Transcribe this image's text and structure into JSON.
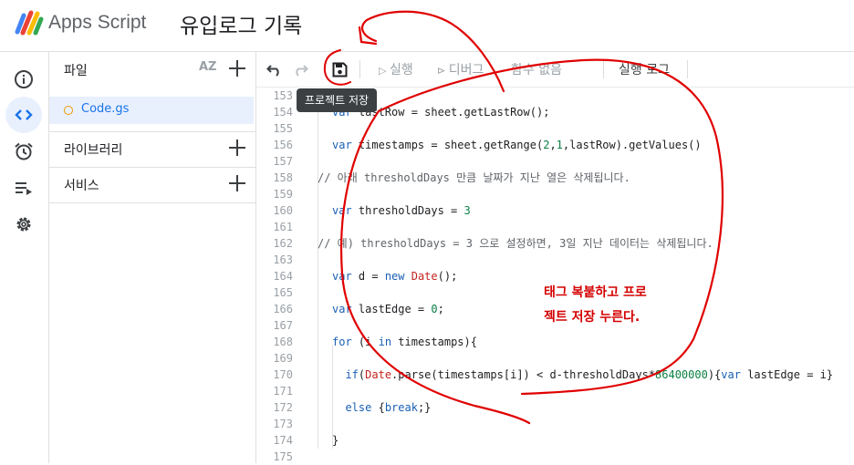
{
  "header": {
    "app_name": "Apps Script",
    "project_title": "유입로그 기록"
  },
  "rail": {
    "items": [
      "overview-icon",
      "editor-icon",
      "triggers-icon",
      "executions-icon",
      "settings-icon"
    ],
    "active": "editor-icon"
  },
  "files": {
    "header_label": "파일",
    "sort_label": "AZ",
    "items": [
      {
        "name": "Code.gs"
      }
    ],
    "libraries_label": "라이브러리",
    "services_label": "서비스"
  },
  "toolbar": {
    "run_label": "실행",
    "debug_label": "디버그",
    "function_label": "함수 없음",
    "log_label": "실행 로그",
    "save_tooltip": "프로젝트 저장"
  },
  "editor": {
    "lines": [
      {
        "n": "153",
        "text": ""
      },
      {
        "n": "154",
        "text": "  var lastRow = sheet.getLastRow();"
      },
      {
        "n": "155",
        "text": ""
      },
      {
        "n": "156",
        "text": "  var timestamps = sheet.getRange(2,1,lastRow).getValues()"
      },
      {
        "n": "157",
        "text": ""
      },
      {
        "n": "158",
        "text": "// 아래 thresholdDays 만큼 날짜가 지난 열은 삭제됩니다."
      },
      {
        "n": "159",
        "text": ""
      },
      {
        "n": "160",
        "text": "  var thresholdDays = 3"
      },
      {
        "n": "161",
        "text": ""
      },
      {
        "n": "162",
        "text": "// 예) thresholdDays = 3 으로 설정하면, 3일 지난 데이터는 삭제됩니다."
      },
      {
        "n": "163",
        "text": ""
      },
      {
        "n": "164",
        "text": "  var d = new Date();"
      },
      {
        "n": "165",
        "text": ""
      },
      {
        "n": "166",
        "text": "  var lastEdge = 0;"
      },
      {
        "n": "167",
        "text": ""
      },
      {
        "n": "168",
        "text": "  for (i in timestamps){"
      },
      {
        "n": "169",
        "text": ""
      },
      {
        "n": "170",
        "text": "    if(Date.parse(timestamps[i]) < d-thresholdDays*86400000){var lastEdge = i}"
      },
      {
        "n": "171",
        "text": ""
      },
      {
        "n": "172",
        "text": "    else {break;}"
      },
      {
        "n": "173",
        "text": ""
      },
      {
        "n": "174",
        "text": "  }"
      },
      {
        "n": "175",
        "text": ""
      }
    ]
  },
  "annotation": {
    "line1": "태그 복붙하고 프로",
    "line2": "젝트 저장 누른다."
  },
  "colors": {
    "accent": "#1a73e8",
    "active_bg": "#e8f0fe",
    "ink": "#e00000",
    "tooltip_bg": "#3c4043"
  }
}
